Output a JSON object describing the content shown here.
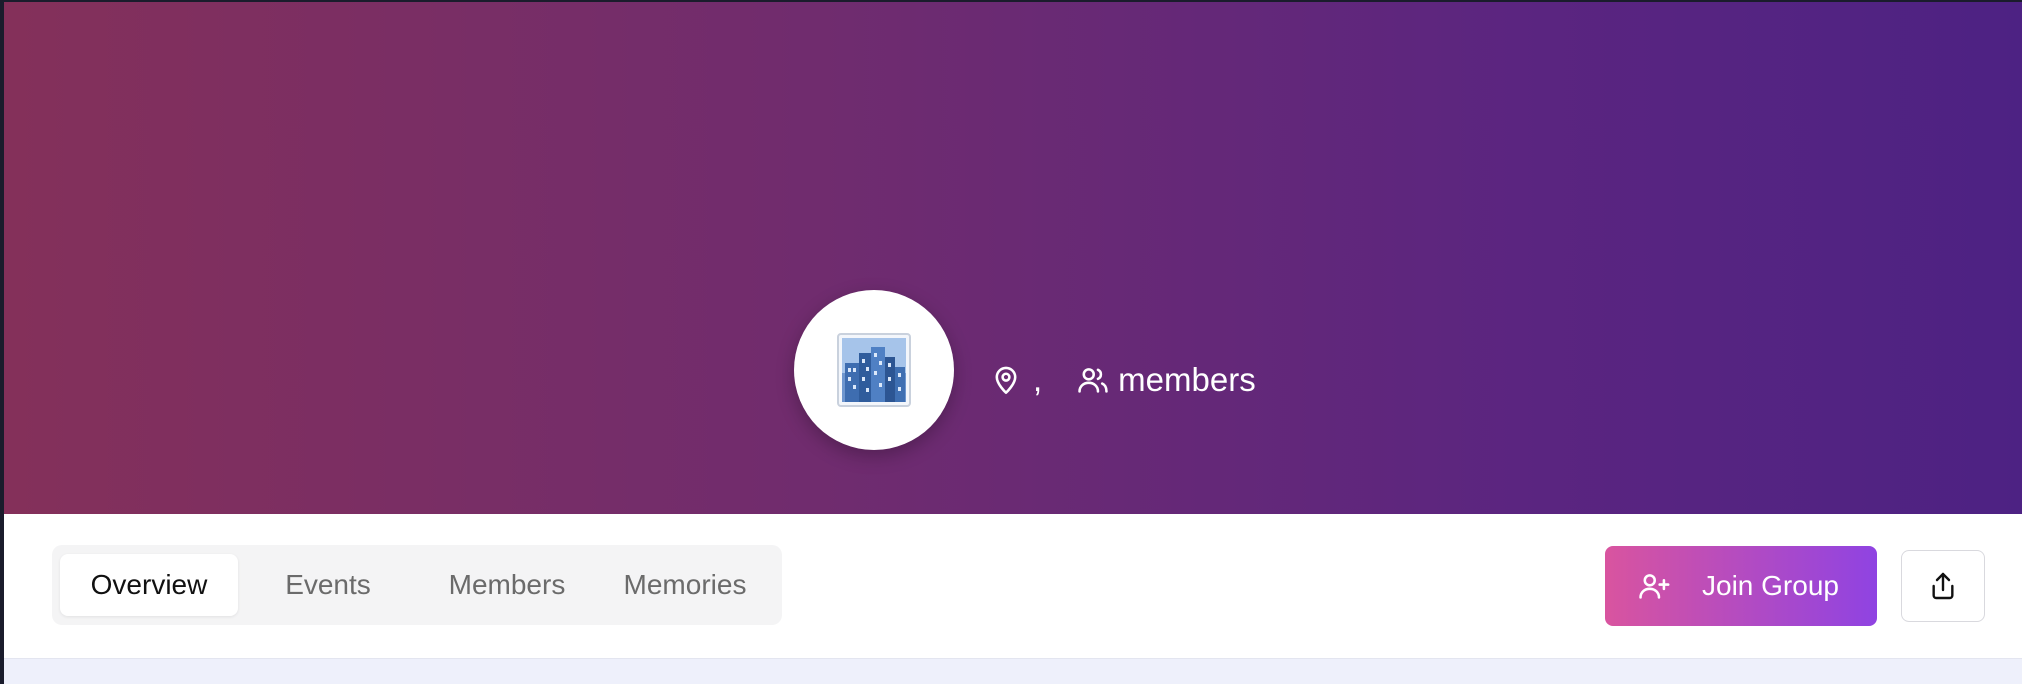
{
  "hero": {
    "gradient_start": "#84305a",
    "gradient_end": "#4d2283",
    "avatar_icon": "cityscape-emoji",
    "location_icon": "map-pin-icon",
    "location_separator": ",",
    "members_icon": "users-icon",
    "members_label": "members"
  },
  "tabs": [
    {
      "label": "Overview",
      "active": true
    },
    {
      "label": "Events",
      "active": false
    },
    {
      "label": "Members",
      "active": false
    },
    {
      "label": "Memories",
      "active": false
    }
  ],
  "actions": {
    "join_label": "Join Group",
    "join_icon": "user-plus-icon",
    "join_gradient": [
      "#d9549f",
      "#8f43e2"
    ],
    "share_icon": "share-icon"
  }
}
